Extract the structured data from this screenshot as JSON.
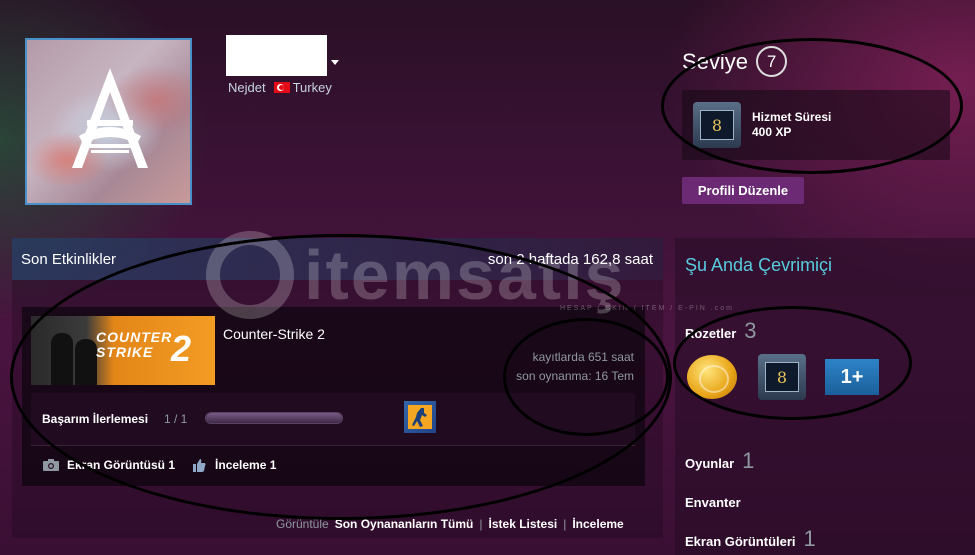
{
  "profile": {
    "name": "Nejdet",
    "country": "Turkey",
    "flag_icon": "turkey-flag-icon"
  },
  "level": {
    "label": "Seviye",
    "value": "7",
    "badge_title": "Hizmet Süresi",
    "badge_xp": "400 XP",
    "badge_number": "8",
    "edit_button": "Profili Düzenle"
  },
  "activity": {
    "title": "Son Etkinlikler",
    "summary": "son 2 haftada 162,8 saat",
    "game": {
      "name": "Counter-Strike 2",
      "image_title_line1": "COUNTER",
      "image_title_line2": "STRIKE",
      "image_title_number": "2",
      "hours_on_record": "kayıtlarda 651 saat",
      "last_played": "son oynanma: 16 Tem"
    },
    "achievement": {
      "label": "Başarım İlerlemesi",
      "count": "1 / 1",
      "progress": 1.0
    },
    "footer": {
      "screenshot": "Ekran Görüntüsü 1",
      "review": "İnceleme 1"
    }
  },
  "links": {
    "prefix": "Görüntüle",
    "items": [
      "Son Oynananların Tümü",
      "İstek Listesi",
      "İnceleme"
    ],
    "separator": "|"
  },
  "sidebar": {
    "online_status": "Şu Anda Çevrimiçi",
    "badges_label": "Rozetler",
    "badges_count": "3",
    "badge_plus_text": "1+",
    "games_label": "Oyunlar",
    "games_count": "1",
    "inventory_label": "Envanter",
    "screenshots_label": "Ekran Görüntüleri",
    "screenshots_count": "1"
  },
  "watermark": {
    "text": "itemsatış",
    "subtext": "HESAP / SKIN / ITEM / E-PIN",
    "domain": ".com"
  },
  "colors": {
    "accent_online": "#57cbde",
    "edit_button_bg": "#6b2a73",
    "annotation_oval": "#000000"
  }
}
